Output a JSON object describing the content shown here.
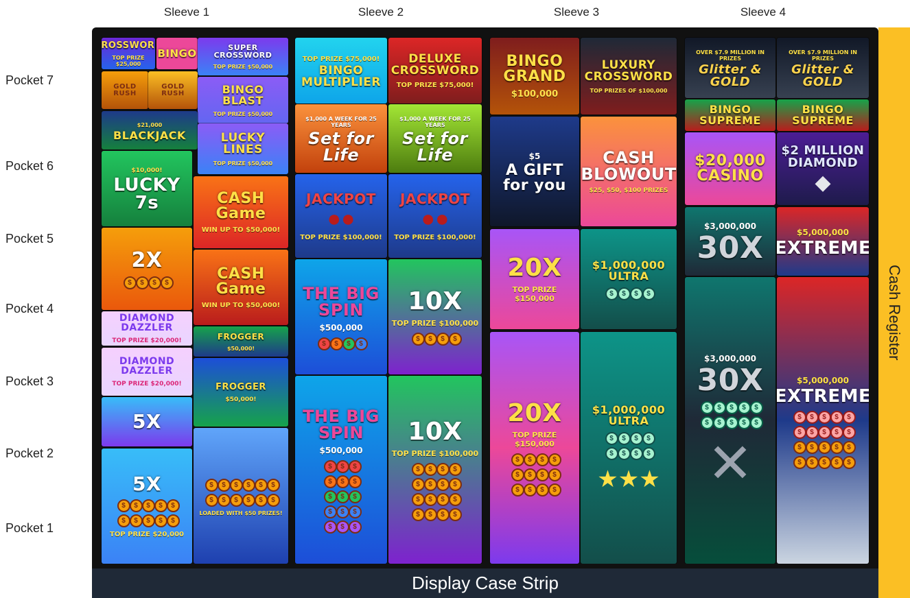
{
  "sleeves": [
    "Sleeve 1",
    "Sleeve 2",
    "Sleeve 3",
    "Sleeve 4"
  ],
  "pockets": [
    "Pocket 7",
    "Pocket 6",
    "Pocket 5",
    "Pocket 4",
    "Pocket 3",
    "Pocket 2",
    "Pocket 1"
  ],
  "strip_label": "Display Case Strip",
  "register_label": "Cash Register",
  "tickets": {
    "s1_crossword": {
      "name": "CROSSWORD",
      "prize": "TOP PRIZE $25,000"
    },
    "s1_bingo": {
      "name": "BINGO"
    },
    "s1_super_crossword": {
      "name": "SUPER CROSSWORD",
      "prize": "TOP PRIZE $50,000"
    },
    "s1_gold_rush_a": {
      "name": "GOLD RUSH"
    },
    "s1_gold_rush_b": {
      "name": "GOLD RUSH"
    },
    "s1_bingo_blast": {
      "name": "BINGO BLAST",
      "prize": "TOP PRIZE $50,000"
    },
    "s1_blackjack": {
      "name": "BLACKJACK",
      "prize": "$21,000"
    },
    "s1_lucky_lines": {
      "name": "LUCKY LINES",
      "prize": "TOP PRIZE $50,000"
    },
    "s1_lucky7s": {
      "name": "LUCKY 7s",
      "prize": "$10,000!"
    },
    "s1_cash_game_a": {
      "name": "CASH Game",
      "prize": "WIN UP TO $50,000!"
    },
    "s1_2x": {
      "name": "2X"
    },
    "s1_cash_game_b": {
      "name": "CASH Game",
      "prize": "WIN UP TO $50,000!"
    },
    "s1_diamond_a": {
      "name": "DIAMOND DAZZLER",
      "prize": "TOP PRIZE $20,000!"
    },
    "s1_froggy_a": {
      "name": "FROGGER",
      "prize": "$50,000!"
    },
    "s1_diamond_b": {
      "name": "DIAMOND DAZZLER",
      "prize": "TOP PRIZE $20,000!"
    },
    "s1_froggy_b": {
      "name": "FROGGER",
      "prize": "$50,000!"
    },
    "s1_5x_a": {
      "name": "5X"
    },
    "s1_5x_b": {
      "name": "5X",
      "prize": "TOP PRIZE $20,000"
    },
    "s1_board": {
      "name": "LOADED WITH $50 PRIZES!"
    },
    "s2_bingo_mult": {
      "name": "BINGO MULTIPLIER",
      "prize": "TOP PRIZE $75,000!"
    },
    "s2_deluxe": {
      "name": "DELUXE CROSSWORD",
      "prize": "TOP PRIZE $75,000!"
    },
    "s2_setlife_a": {
      "name": "Set for Life",
      "prize": "$1,000 A WEEK FOR 25 YEARS"
    },
    "s2_setlife_b": {
      "name": "Set for Life",
      "prize": "$1,000 A WEEK FOR 25 YEARS"
    },
    "s2_jackpot_a": {
      "name": "JACKPOT",
      "prize": "TOP PRIZE $100,000!"
    },
    "s2_jackpot_b": {
      "name": "JACKPOT",
      "prize": "TOP PRIZE $100,000!"
    },
    "s2_bigspin_a": {
      "name": "THE BIG SPIN",
      "prize": "$500,000"
    },
    "s2_10x_a": {
      "name": "10X",
      "prize": "TOP PRIZE $100,000"
    },
    "s2_bigspin_b": {
      "name": "THE BIG SPIN",
      "prize": "$500,000"
    },
    "s2_10x_b": {
      "name": "10X",
      "prize": "TOP PRIZE $100,000"
    },
    "s3_bingo_grand": {
      "name": "BINGO GRAND",
      "prize": "$100,000"
    },
    "s3_luxury": {
      "name": "LUXURY CROSSWORD",
      "prize": "TOP PRIZES OF $100,000"
    },
    "s3_gift": {
      "name": "A GIFT for you",
      "prize": "$5"
    },
    "s3_blowout": {
      "name": "CASH BLOWOUT",
      "prize": "$25, $50, $100 PRIZES"
    },
    "s3_20x_a": {
      "name": "20X",
      "prize": "TOP PRIZE $150,000"
    },
    "s3_ultra_a": {
      "name": "$1,000,000 ULTRA"
    },
    "s3_20x_b": {
      "name": "20X",
      "prize": "TOP PRIZE $150,000"
    },
    "s3_ultra_b": {
      "name": "$1,000,000 ULTRA"
    },
    "s4_glitter_a": {
      "name": "Glitter & GOLD",
      "prize": "OVER $7.9 MILLION IN PRIZES"
    },
    "s4_glitter_b": {
      "name": "Glitter & GOLD",
      "prize": "OVER $7.9 MILLION IN PRIZES"
    },
    "s4_supreme_a": {
      "name": "BINGO SUPREME"
    },
    "s4_supreme_b": {
      "name": "BINGO SUPREME"
    },
    "s4_casino": {
      "name": "$20,000 CASINO"
    },
    "s4_diamond": {
      "name": "$2 MILLION DIAMOND"
    },
    "s4_30x_a": {
      "name": "30X",
      "prize": "$3,000,000"
    },
    "s4_extreme_a": {
      "name": "EXTREME",
      "prize": "$5,000,000"
    },
    "s4_30x_b": {
      "name": "30X",
      "prize": "$3,000,000"
    },
    "s4_extreme_b": {
      "name": "EXTREME",
      "prize": "$5,000,000"
    }
  },
  "colors": {
    "case": "#111111",
    "strip": "#1f2937",
    "register": "#fbbf24"
  }
}
